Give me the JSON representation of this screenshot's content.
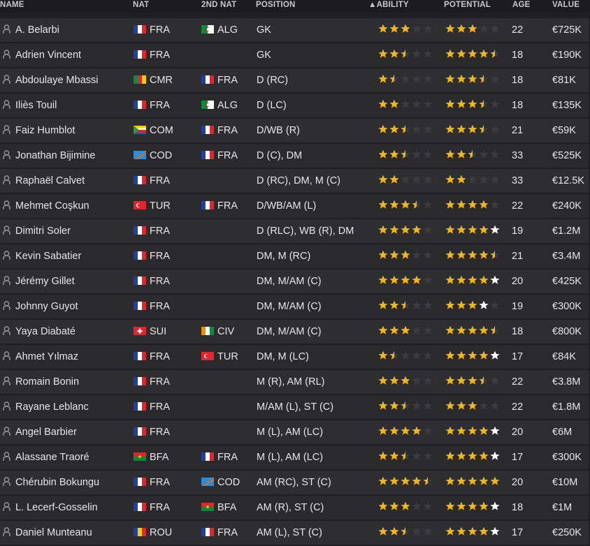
{
  "columns": {
    "name": "NAME",
    "nat": "NAT",
    "nat2": "2ND NAT",
    "position": "POSITION",
    "ability": "▲ABILITY",
    "potential": "POTENTIAL",
    "age": "AGE",
    "value": "VALUE"
  },
  "colors": {
    "star_filled": "#f5b70f",
    "star_empty": "#3c3c3e",
    "star_white": "#ffffff"
  },
  "flags": {
    "FRA": [
      "#1f3fa8",
      "#ffffff",
      "#e2262f"
    ],
    "ALG": [
      "#0a8a3a",
      "#ffffff"
    ],
    "CMR": [
      "#0a8a3a",
      "#e2262f",
      "#f5d000"
    ],
    "COM": [
      "#f5d000",
      "#ffffff",
      "#e2262f",
      "#2a55c5"
    ],
    "COD": [
      "#2a8ee0",
      "#f5d000",
      "#d01c1f"
    ],
    "TUR": [
      "#e2262f"
    ],
    "SUI": [
      "#e2262f"
    ],
    "CIV": [
      "#f58b00",
      "#ffffff",
      "#0a8a3a"
    ],
    "BFA": [
      "#e2262f",
      "#0a8a3a"
    ],
    "ROU": [
      "#1f3fa8",
      "#f5d000",
      "#e2262f"
    ]
  },
  "players": [
    {
      "name": "A. Belarbi",
      "nat": "FRA",
      "nat2": "ALG",
      "position": "GK",
      "ability": 3,
      "potential": 3,
      "potential_full": false,
      "age": "22",
      "value": "€725K"
    },
    {
      "name": "Adrien Vincent",
      "nat": "FRA",
      "nat2": "",
      "position": "GK",
      "ability": 2.5,
      "potential": 4.5,
      "potential_full": false,
      "age": "18",
      "value": "€190K"
    },
    {
      "name": "Abdoulaye Mbassi",
      "nat": "CMR",
      "nat2": "FRA",
      "position": "D (RC)",
      "ability": 1.5,
      "potential": 3.5,
      "potential_full": false,
      "age": "18",
      "value": "€81K"
    },
    {
      "name": "Iliès Touil",
      "nat": "FRA",
      "nat2": "ALG",
      "position": "D (LC)",
      "ability": 2,
      "potential": 3.5,
      "potential_full": false,
      "age": "18",
      "value": "€135K"
    },
    {
      "name": "Faiz Humblot",
      "nat": "COM",
      "nat2": "FRA",
      "position": "D/WB (R)",
      "ability": 2.5,
      "potential": 3.5,
      "potential_full": false,
      "age": "21",
      "value": "€59K"
    },
    {
      "name": "Jonathan Bijimine",
      "nat": "COD",
      "nat2": "FRA",
      "position": "D (C), DM",
      "ability": 2.5,
      "potential": 2.5,
      "potential_full": false,
      "age": "33",
      "value": "€525K"
    },
    {
      "name": "Raphaël Calvet",
      "nat": "FRA",
      "nat2": "",
      "position": "D (RC), DM, M (C)",
      "ability": 2,
      "potential": 2,
      "potential_full": false,
      "age": "33",
      "value": "€12.5K"
    },
    {
      "name": "Mehmet Coşkun",
      "nat": "TUR",
      "nat2": "FRA",
      "position": "D/WB/AM (L)",
      "ability": 3.5,
      "potential": 4,
      "potential_full": false,
      "age": "22",
      "value": "€240K"
    },
    {
      "name": "Dimitri Soler",
      "nat": "FRA",
      "nat2": "",
      "position": "D (RLC), WB (R), DM",
      "ability": 4,
      "potential": 4,
      "potential_full": true,
      "age": "19",
      "value": "€1.2M"
    },
    {
      "name": "Kevin Sabatier",
      "nat": "FRA",
      "nat2": "",
      "position": "DM, M (RC)",
      "ability": 3,
      "potential": 4.5,
      "potential_full": false,
      "age": "21",
      "value": "€3.4M"
    },
    {
      "name": "Jérémy Gillet",
      "nat": "FRA",
      "nat2": "",
      "position": "DM, M/AM (C)",
      "ability": 4,
      "potential": 4,
      "potential_full": true,
      "age": "20",
      "value": "€425K"
    },
    {
      "name": "Johnny Guyot",
      "nat": "FRA",
      "nat2": "",
      "position": "DM, M/AM (C)",
      "ability": 2.5,
      "potential": 3,
      "potential_full": true,
      "age": "19",
      "value": "€300K"
    },
    {
      "name": "Yaya Diabaté",
      "nat": "SUI",
      "nat2": "CIV",
      "position": "DM, M/AM (C)",
      "ability": 3,
      "potential": 4.5,
      "potential_full": false,
      "age": "18",
      "value": "€800K"
    },
    {
      "name": "Ahmet Yılmaz",
      "nat": "FRA",
      "nat2": "TUR",
      "position": "DM, M (LC)",
      "ability": 1.5,
      "potential": 4,
      "potential_full": true,
      "age": "17",
      "value": "€84K"
    },
    {
      "name": "Romain Bonin",
      "nat": "FRA",
      "nat2": "",
      "position": "M (R), AM (RL)",
      "ability": 3,
      "potential": 3.5,
      "potential_full": false,
      "age": "22",
      "value": "€3.8M"
    },
    {
      "name": "Rayane Leblanc",
      "nat": "FRA",
      "nat2": "",
      "position": "M/AM (L), ST (C)",
      "ability": 2.5,
      "potential": 3,
      "potential_full": false,
      "age": "22",
      "value": "€1.8M"
    },
    {
      "name": "Angel Barbier",
      "nat": "FRA",
      "nat2": "",
      "position": "M (L), AM (LC)",
      "ability": 4,
      "potential": 4,
      "potential_full": true,
      "age": "20",
      "value": "€6M"
    },
    {
      "name": "Alassane Traoré",
      "nat": "BFA",
      "nat2": "FRA",
      "position": "M (L), AM (LC)",
      "ability": 2.5,
      "potential": 4,
      "potential_full": true,
      "age": "17",
      "value": "€300K"
    },
    {
      "name": "Chérubin Bokungu",
      "nat": "FRA",
      "nat2": "COD",
      "position": "AM (RC), ST (C)",
      "ability": 4.5,
      "potential": 5,
      "potential_full": false,
      "age": "20",
      "value": "€10M"
    },
    {
      "name": "L. Lecerf-Gosselin",
      "nat": "FRA",
      "nat2": "BFA",
      "position": "AM (R), ST (C)",
      "ability": 3,
      "potential": 4,
      "potential_full": true,
      "age": "18",
      "value": "€1M"
    },
    {
      "name": "Daniel Munteanu",
      "nat": "ROU",
      "nat2": "FRA",
      "position": "AM (L), ST (C)",
      "ability": 2.5,
      "potential": 4,
      "potential_full": true,
      "age": "17",
      "value": "€250K"
    }
  ]
}
